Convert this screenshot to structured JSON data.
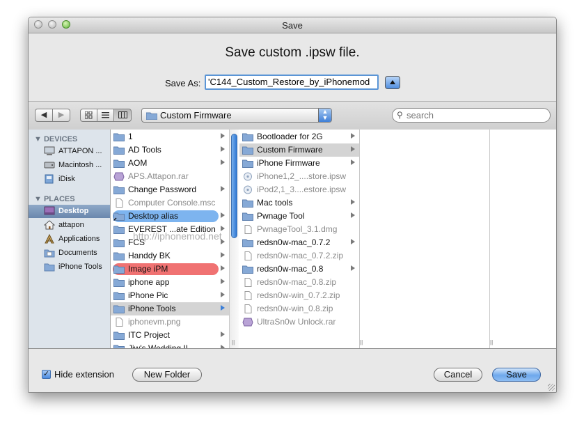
{
  "window": {
    "title": "Save"
  },
  "dialog": {
    "heading": "Save custom .ipsw file.",
    "save_as_label": "Save As:",
    "filename": "'C144_Custom_Restore_by_iPhonemod"
  },
  "toolbar": {
    "back": "◀",
    "forward": "▶",
    "location": "Custom Firmware",
    "search_placeholder": "search"
  },
  "sidebar": {
    "devices_header": "DEVICES",
    "devices": [
      {
        "label": "ATTAPON ...",
        "icon": "computer-icon"
      },
      {
        "label": "Macintosh ...",
        "icon": "hard-drive-icon"
      },
      {
        "label": "iDisk",
        "icon": "idisk-icon"
      }
    ],
    "places_header": "PLACES",
    "places": [
      {
        "label": "Desktop",
        "icon": "desktop-icon",
        "selected": true
      },
      {
        "label": "attapon",
        "icon": "home-icon"
      },
      {
        "label": "Applications",
        "icon": "applications-icon"
      },
      {
        "label": "Documents",
        "icon": "documents-folder-icon"
      },
      {
        "label": "iPhone Tools",
        "icon": "folder-icon"
      }
    ]
  },
  "column1": [
    {
      "label": "1",
      "kind": "folder"
    },
    {
      "label": "AD Tools",
      "kind": "folder"
    },
    {
      "label": "AOM",
      "kind": "folder"
    },
    {
      "label": "APS.Attapon.rar",
      "kind": "archive"
    },
    {
      "label": "Change Password",
      "kind": "folder"
    },
    {
      "label": "Computer Console.msc",
      "kind": "file"
    },
    {
      "label": "Desktop alias",
      "kind": "alias",
      "label_color": "#7db4ef"
    },
    {
      "label": "EVEREST ...ate Edition",
      "kind": "folder"
    },
    {
      "label": "FCS",
      "kind": "folder"
    },
    {
      "label": "Handdy BK",
      "kind": "folder"
    },
    {
      "label": "Image iPM",
      "kind": "folder",
      "label_color": "#f07272"
    },
    {
      "label": "iphone app",
      "kind": "folder"
    },
    {
      "label": "iPhone Pic",
      "kind": "folder"
    },
    {
      "label": "iPhone Tools",
      "kind": "folder",
      "selected": true
    },
    {
      "label": "iphonevm.png",
      "kind": "file"
    },
    {
      "label": "ITC Project",
      "kind": "folder"
    },
    {
      "label": "Jiw's Wedding II",
      "kind": "folder"
    }
  ],
  "column2": [
    {
      "label": "Bootloader for 2G",
      "kind": "folder"
    },
    {
      "label": "Custom Firmware",
      "kind": "folder",
      "selected": true
    },
    {
      "label": "iPhone Firmware",
      "kind": "folder"
    },
    {
      "label": "iPhone1,2_....store.ipsw",
      "kind": "ipsw"
    },
    {
      "label": "iPod2,1_3....estore.ipsw",
      "kind": "ipsw"
    },
    {
      "label": "Mac tools",
      "kind": "folder"
    },
    {
      "label": "Pwnage Tool",
      "kind": "folder"
    },
    {
      "label": "PwnageTool_3.1.dmg",
      "kind": "file"
    },
    {
      "label": "redsn0w-mac_0.7.2",
      "kind": "folder"
    },
    {
      "label": "redsn0w-mac_0.7.2.zip",
      "kind": "file"
    },
    {
      "label": "redsn0w-mac_0.8",
      "kind": "folder"
    },
    {
      "label": "redsn0w-mac_0.8.zip",
      "kind": "file"
    },
    {
      "label": "redsn0w-win_0.7.2.zip",
      "kind": "file"
    },
    {
      "label": "redsn0w-win_0.8.zip",
      "kind": "file"
    },
    {
      "label": "UltraSn0w Unlock.rar",
      "kind": "archive"
    }
  ],
  "watermark": "http://iphonemod.net",
  "bottom": {
    "hide_extension_label": "Hide extension",
    "hide_extension_checked": true,
    "new_folder": "New Folder",
    "cancel": "Cancel",
    "save": "Save"
  },
  "colors": {
    "accent_blue": "#5b95d6",
    "folder_blue": "#86a9d6",
    "sidebar_bg": "#dde4eb"
  }
}
